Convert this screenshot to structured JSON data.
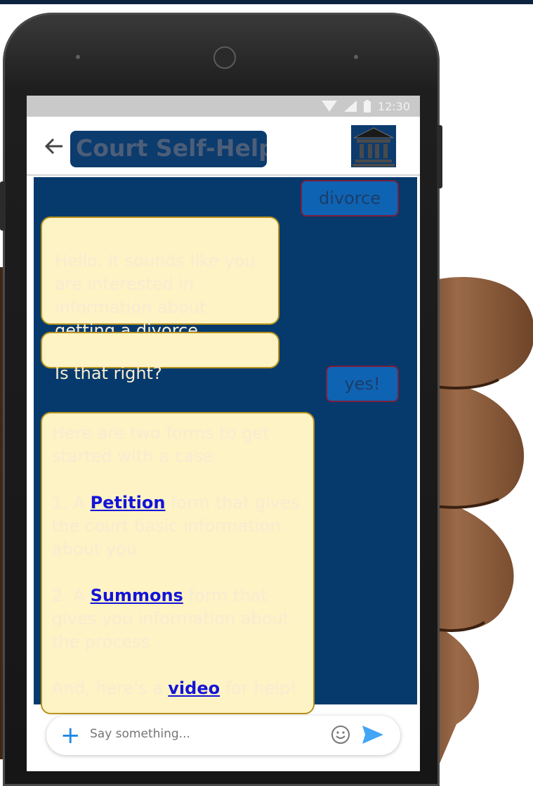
{
  "status_bar": {
    "time": "12:30"
  },
  "header": {
    "title": "Court Self-Help"
  },
  "messages": [
    {
      "from": "user",
      "text": "divorce"
    },
    {
      "from": "bot",
      "text": "Hello, it sounds like you are interested in information about getting a divorce."
    },
    {
      "from": "bot",
      "text": "Is that right?"
    },
    {
      "from": "user",
      "text": "yes!"
    },
    {
      "from": "bot",
      "intro": "Here are two forms to get started with a case:",
      "item1_prefix": "1. A ",
      "item1_link": "Petition",
      "item1_suffix": " form that gives the court basic information about you",
      "item2_prefix": "2. A ",
      "item2_link": "Summons",
      "item2_suffix": " form that gives you information about the process",
      "outro_prefix": "And, here's a ",
      "outro_link": "video",
      "outro_suffix": " for help!"
    }
  ],
  "input": {
    "placeholder": "Say something..."
  },
  "colors": {
    "chat_bg": "#063a6c",
    "bot_bubble": "#fdf3c4",
    "user_bubble": "#0f63b3",
    "link": "#1414d8"
  }
}
